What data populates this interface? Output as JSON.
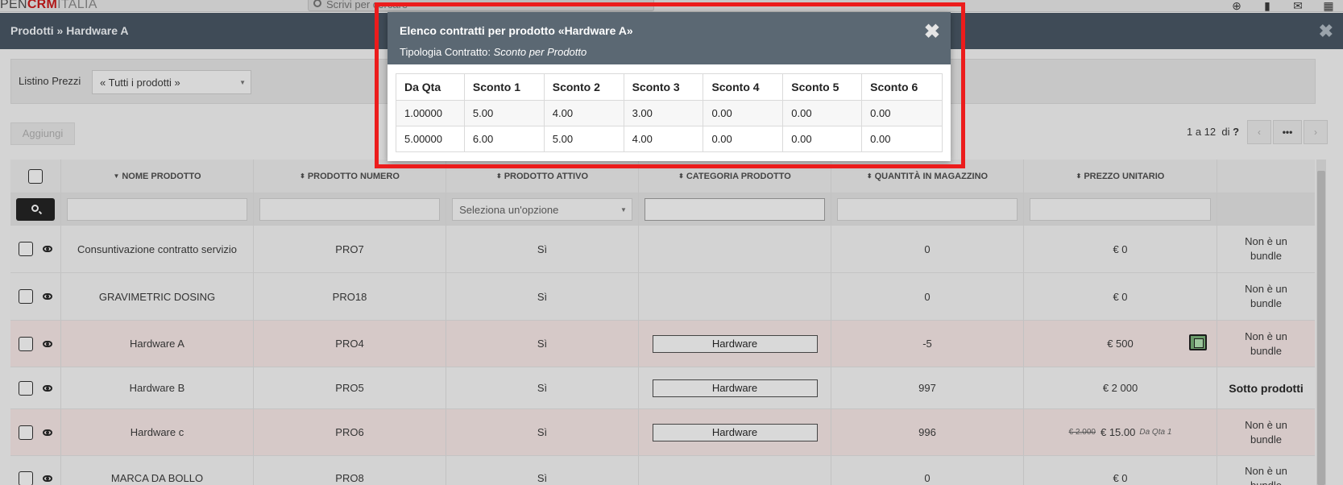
{
  "topbar": {
    "brand_part1": "PEN",
    "brand_part2": "CRM",
    "brand_part3": "ITALIA",
    "search_placeholder": "Scrivi per cercare"
  },
  "titlebar": {
    "title": "Prodotti » Hardware A",
    "close_glyph": "✖"
  },
  "filter": {
    "label": "Listino Prezzi",
    "selected": "« Tutti i prodotti »"
  },
  "toolbar": {
    "add_label": "Aggiungi"
  },
  "pager": {
    "range": "1 a 12",
    "of": "di",
    "total": "?",
    "more_glyph": "•••",
    "prev_glyph": "‹",
    "next_glyph": "›"
  },
  "table": {
    "headers": [
      "NOME PRODOTTO",
      "PRODOTTO NUMERO",
      "PRODOTTO ATTIVO",
      "CATEGORIA PRODOTTO",
      "QUANTITÀ IN MAGAZZINO",
      "PREZZO UNITARIO"
    ],
    "active_filter_placeholder": "Seleziona un'opzione",
    "rows": [
      {
        "name": "Consuntivazione contratto servizio",
        "number": "PRO7",
        "active": "Sì",
        "category": "",
        "qty": "0",
        "price": "€ 0",
        "bundle": "Non è un bundle"
      },
      {
        "name": "GRAVIMETRIC DOSING",
        "number": "PRO18",
        "active": "Sì",
        "category": "",
        "qty": "0",
        "price": "€ 0",
        "bundle": "Non è un bundle"
      },
      {
        "name": "Hardware A",
        "number": "PRO4",
        "active": "Sì",
        "category": "Hardware",
        "qty": "-5",
        "price": "€ 500",
        "bundle": "Non è un bundle"
      },
      {
        "name": "Hardware B",
        "number": "PRO5",
        "active": "Sì",
        "category": "Hardware",
        "qty": "997",
        "price": "€ 2 000",
        "bundle": "Sotto prodotti"
      },
      {
        "name": "Hardware c",
        "number": "PRO6",
        "active": "Sì",
        "category": "Hardware",
        "qty": "996",
        "price_old": "€ 2.000",
        "price": "€ 15.00",
        "price_note": "Da Qta 1",
        "bundle": "Non è un bundle"
      },
      {
        "name": "MARCA DA BOLLO",
        "number": "PRO8",
        "active": "Sì",
        "category": "",
        "qty": "0",
        "price": "€ 0",
        "bundle": "Non è un bundle"
      }
    ]
  },
  "modal": {
    "title": "Elenco contratti per prodotto «Hardware A»",
    "subtitle_label": "Tipologia Contratto:",
    "subtitle_value": "Sconto per Prodotto",
    "close_glyph": "✖",
    "columns": [
      "Da Qta",
      "Sconto 1",
      "Sconto 2",
      "Sconto 3",
      "Sconto 4",
      "Sconto 5",
      "Sconto 6"
    ],
    "rows": [
      [
        "1.00000",
        "5.00",
        "4.00",
        "3.00",
        "0.00",
        "0.00",
        "0.00"
      ],
      [
        "5.00000",
        "6.00",
        "5.00",
        "4.00",
        "0.00",
        "0.00",
        "0.00"
      ]
    ]
  }
}
